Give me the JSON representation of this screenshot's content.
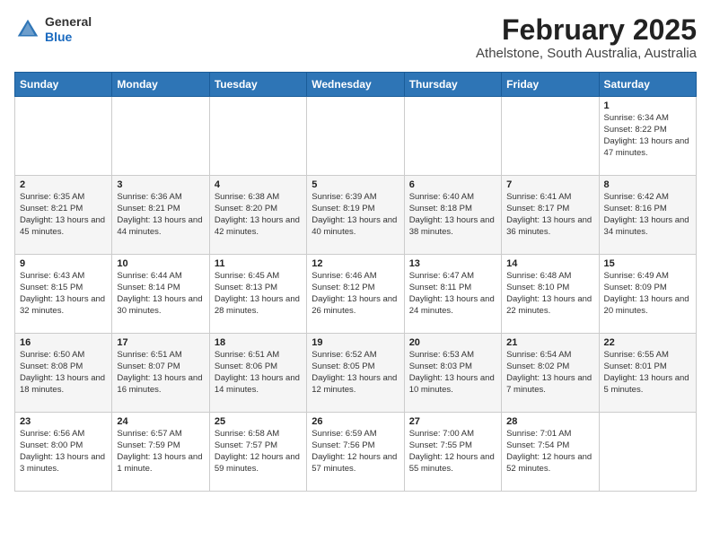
{
  "logo": {
    "general": "General",
    "blue": "Blue"
  },
  "title": "February 2025",
  "subtitle": "Athelstone, South Australia, Australia",
  "weekdays": [
    "Sunday",
    "Monday",
    "Tuesday",
    "Wednesday",
    "Thursday",
    "Friday",
    "Saturday"
  ],
  "weeks": [
    [
      {
        "day": "",
        "info": ""
      },
      {
        "day": "",
        "info": ""
      },
      {
        "day": "",
        "info": ""
      },
      {
        "day": "",
        "info": ""
      },
      {
        "day": "",
        "info": ""
      },
      {
        "day": "",
        "info": ""
      },
      {
        "day": "1",
        "info": "Sunrise: 6:34 AM\nSunset: 8:22 PM\nDaylight: 13 hours and 47 minutes."
      }
    ],
    [
      {
        "day": "2",
        "info": "Sunrise: 6:35 AM\nSunset: 8:21 PM\nDaylight: 13 hours and 45 minutes."
      },
      {
        "day": "3",
        "info": "Sunrise: 6:36 AM\nSunset: 8:21 PM\nDaylight: 13 hours and 44 minutes."
      },
      {
        "day": "4",
        "info": "Sunrise: 6:38 AM\nSunset: 8:20 PM\nDaylight: 13 hours and 42 minutes."
      },
      {
        "day": "5",
        "info": "Sunrise: 6:39 AM\nSunset: 8:19 PM\nDaylight: 13 hours and 40 minutes."
      },
      {
        "day": "6",
        "info": "Sunrise: 6:40 AM\nSunset: 8:18 PM\nDaylight: 13 hours and 38 minutes."
      },
      {
        "day": "7",
        "info": "Sunrise: 6:41 AM\nSunset: 8:17 PM\nDaylight: 13 hours and 36 minutes."
      },
      {
        "day": "8",
        "info": "Sunrise: 6:42 AM\nSunset: 8:16 PM\nDaylight: 13 hours and 34 minutes."
      }
    ],
    [
      {
        "day": "9",
        "info": "Sunrise: 6:43 AM\nSunset: 8:15 PM\nDaylight: 13 hours and 32 minutes."
      },
      {
        "day": "10",
        "info": "Sunrise: 6:44 AM\nSunset: 8:14 PM\nDaylight: 13 hours and 30 minutes."
      },
      {
        "day": "11",
        "info": "Sunrise: 6:45 AM\nSunset: 8:13 PM\nDaylight: 13 hours and 28 minutes."
      },
      {
        "day": "12",
        "info": "Sunrise: 6:46 AM\nSunset: 8:12 PM\nDaylight: 13 hours and 26 minutes."
      },
      {
        "day": "13",
        "info": "Sunrise: 6:47 AM\nSunset: 8:11 PM\nDaylight: 13 hours and 24 minutes."
      },
      {
        "day": "14",
        "info": "Sunrise: 6:48 AM\nSunset: 8:10 PM\nDaylight: 13 hours and 22 minutes."
      },
      {
        "day": "15",
        "info": "Sunrise: 6:49 AM\nSunset: 8:09 PM\nDaylight: 13 hours and 20 minutes."
      }
    ],
    [
      {
        "day": "16",
        "info": "Sunrise: 6:50 AM\nSunset: 8:08 PM\nDaylight: 13 hours and 18 minutes."
      },
      {
        "day": "17",
        "info": "Sunrise: 6:51 AM\nSunset: 8:07 PM\nDaylight: 13 hours and 16 minutes."
      },
      {
        "day": "18",
        "info": "Sunrise: 6:51 AM\nSunset: 8:06 PM\nDaylight: 13 hours and 14 minutes."
      },
      {
        "day": "19",
        "info": "Sunrise: 6:52 AM\nSunset: 8:05 PM\nDaylight: 13 hours and 12 minutes."
      },
      {
        "day": "20",
        "info": "Sunrise: 6:53 AM\nSunset: 8:03 PM\nDaylight: 13 hours and 10 minutes."
      },
      {
        "day": "21",
        "info": "Sunrise: 6:54 AM\nSunset: 8:02 PM\nDaylight: 13 hours and 7 minutes."
      },
      {
        "day": "22",
        "info": "Sunrise: 6:55 AM\nSunset: 8:01 PM\nDaylight: 13 hours and 5 minutes."
      }
    ],
    [
      {
        "day": "23",
        "info": "Sunrise: 6:56 AM\nSunset: 8:00 PM\nDaylight: 13 hours and 3 minutes."
      },
      {
        "day": "24",
        "info": "Sunrise: 6:57 AM\nSunset: 7:59 PM\nDaylight: 13 hours and 1 minute."
      },
      {
        "day": "25",
        "info": "Sunrise: 6:58 AM\nSunset: 7:57 PM\nDaylight: 12 hours and 59 minutes."
      },
      {
        "day": "26",
        "info": "Sunrise: 6:59 AM\nSunset: 7:56 PM\nDaylight: 12 hours and 57 minutes."
      },
      {
        "day": "27",
        "info": "Sunrise: 7:00 AM\nSunset: 7:55 PM\nDaylight: 12 hours and 55 minutes."
      },
      {
        "day": "28",
        "info": "Sunrise: 7:01 AM\nSunset: 7:54 PM\nDaylight: 12 hours and 52 minutes."
      },
      {
        "day": "",
        "info": ""
      }
    ]
  ]
}
